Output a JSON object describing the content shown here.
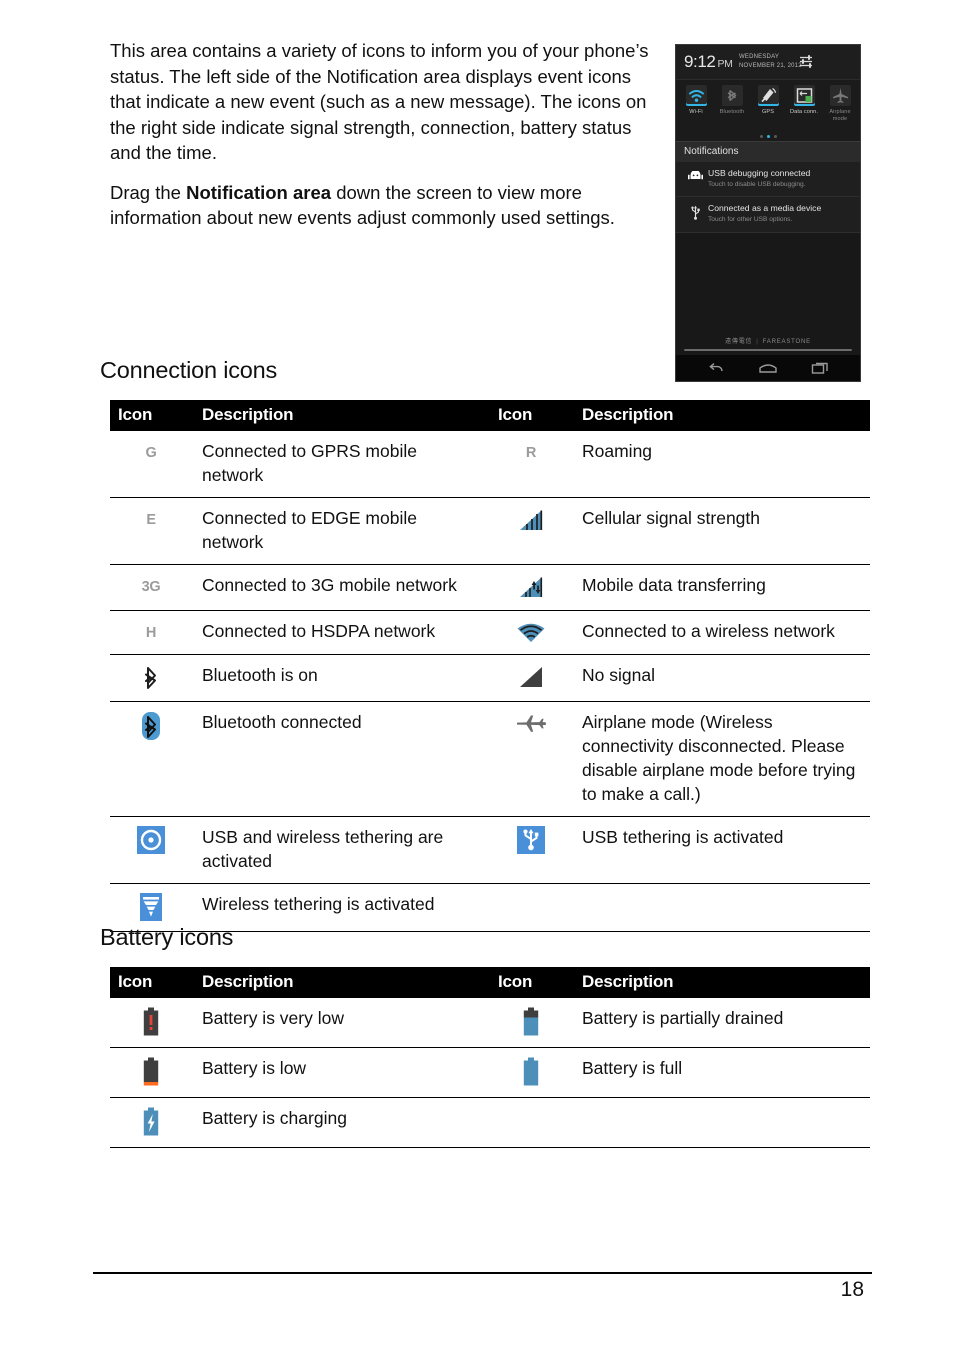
{
  "intro": {
    "paragraph_1": "This area contains a variety of icons to inform you of your phone’s status. The left side of the Notification area displays event icons that indicate a new event (such as a new message). The icons on the right side indicate signal strength, connection, battery status and the time.",
    "paragraph_2_before": "Drag the ",
    "paragraph_2_bold": "Notification area",
    "paragraph_2_after": " down the screen to view more information about new events adjust commonly used settings."
  },
  "phone_screenshot": {
    "status_bar": {
      "time": "9:12",
      "ampm": "PM",
      "day": "WEDNESDAY",
      "date": "NOVEMBER 21, 2012",
      "settings_icon": "settings-sliders-icon"
    },
    "quick_toggles": [
      {
        "label": "Wi-Fi",
        "icon": "wifi-icon",
        "state": "on"
      },
      {
        "label": "Bluetooth",
        "icon": "bluetooth-icon",
        "state": "off"
      },
      {
        "label": "GPS",
        "icon": "gps-icon",
        "state": "on"
      },
      {
        "label": "Data conn.",
        "icon": "data-connection-icon",
        "state": "on"
      },
      {
        "label": "Airplane\nmode",
        "icon": "airplane-icon",
        "state": "off"
      }
    ],
    "page_dots": {
      "count": 3,
      "active_index": 1
    },
    "notifications_header": "Notifications",
    "notifications": [
      {
        "icon": "android-robot-icon",
        "title": "USB debugging connected",
        "subtitle": "Touch to disable USB debugging."
      },
      {
        "icon": "usb-icon",
        "title": "Connected as a media device",
        "subtitle": "Touch for other USB options."
      }
    ],
    "carrier_left": "遠傳電信",
    "carrier_separator": "|",
    "carrier_right": "FAREASTONE",
    "nav_bar": [
      "back-icon",
      "home-icon",
      "recent-apps-icon"
    ]
  },
  "connection_section": {
    "title": "Connection icons",
    "headers": {
      "icon": "Icon",
      "description": "Description"
    },
    "rows": [
      {
        "left": {
          "icon": "gprs-g-icon",
          "text": "Connected to GPRS mobile network"
        },
        "right": {
          "icon": "roaming-r-icon",
          "text": "Roaming"
        }
      },
      {
        "left": {
          "icon": "edge-e-icon",
          "text": "Connected to EDGE mobile network"
        },
        "right": {
          "icon": "signal-bars-icon",
          "text": "Cellular signal strength"
        }
      },
      {
        "left": {
          "icon": "3g-icon",
          "text": "Connected to 3G mobile network"
        },
        "right": {
          "icon": "data-transfer-icon",
          "text": "Mobile data transferring"
        }
      },
      {
        "left": {
          "icon": "hsdpa-h-icon",
          "text": "Connected to HSDPA network"
        },
        "right": {
          "icon": "wifi-connected-icon",
          "text": "Connected to a wireless network"
        }
      },
      {
        "left": {
          "icon": "bluetooth-on-icon",
          "text": "Bluetooth is on"
        },
        "right": {
          "icon": "no-signal-icon",
          "text": "No signal"
        }
      },
      {
        "left": {
          "icon": "bluetooth-connected-icon",
          "text": "Bluetooth connected"
        },
        "right": {
          "icon": "airplane-mode-icon",
          "text": "Airplane mode (Wireless connectivity disconnected. Please disable airplane mode before trying to make a call.)"
        }
      },
      {
        "left": {
          "icon": "usb-wireless-tethering-icon",
          "text": "USB and wireless tethering are activated"
        },
        "right": {
          "icon": "usb-tethering-icon",
          "text": "USB tethering is activated"
        }
      },
      {
        "left": {
          "icon": "wireless-tethering-icon",
          "text": "Wireless tethering is activated"
        },
        "right": {
          "icon": "",
          "text": ""
        }
      }
    ]
  },
  "battery_section": {
    "title": "Battery icons",
    "headers": {
      "icon": "Icon",
      "description": "Description"
    },
    "rows": [
      {
        "left": {
          "icon": "battery-very-low-icon",
          "text": "Battery is very low"
        },
        "right": {
          "icon": "battery-partial-icon",
          "text": "Battery is partially drained"
        }
      },
      {
        "left": {
          "icon": "battery-low-icon",
          "text": "Battery is low"
        },
        "right": {
          "icon": "battery-full-icon",
          "text": "Battery is full"
        }
      },
      {
        "left": {
          "icon": "battery-charging-icon",
          "text": "Battery is charging"
        },
        "right": {
          "icon": "",
          "text": ""
        }
      }
    ]
  },
  "footer": {
    "page_number": "18"
  },
  "colors": {
    "accent_blue": "#4a90d9",
    "signal_blue": "#4d8fb8",
    "android_blue": "#33b5e5",
    "battery_orange": "#ff6a1e",
    "battery_red": "#e8413a",
    "dark_gray": "#3f3f3f",
    "header_black": "#000000"
  }
}
